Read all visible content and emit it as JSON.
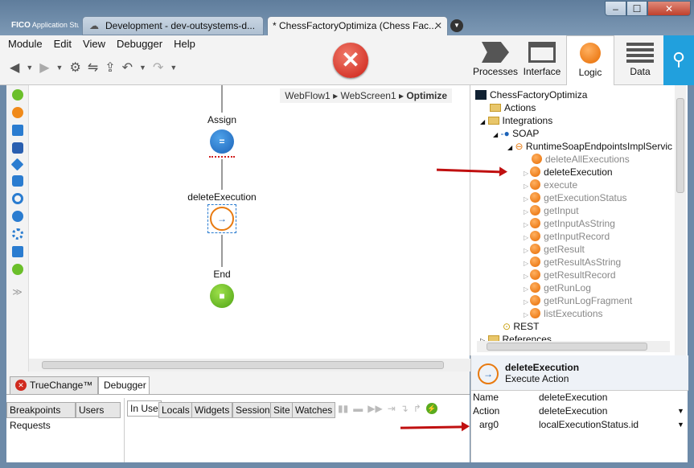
{
  "window": {
    "tabs": [
      {
        "label": "Development - dev-outsystems-d..."
      },
      {
        "label": "* ChessFactoryOptimiza (Chess Fac..."
      }
    ],
    "brand": "FICO",
    "brand_sub": "Application Studio"
  },
  "menu": [
    "Module",
    "Edit",
    "View",
    "Debugger",
    "Help"
  ],
  "nav": {
    "processes": "Processes",
    "interface": "Interface",
    "logic": "Logic",
    "data": "Data"
  },
  "breadcrumb": {
    "part1": "WebFlow1",
    "part2": "WebScreen1",
    "part3": "Optimize"
  },
  "flow": {
    "assign_label": "Assign",
    "action_label": "deleteExecution",
    "end_label": "End"
  },
  "tree": {
    "root": "ChessFactoryOptimiza",
    "actions": "Actions",
    "integrations": "Integrations",
    "soap": "SOAP",
    "service": "RuntimeSoapEndpointsImplServic",
    "methods": [
      "deleteAllExecutions",
      "deleteExecution",
      "execute",
      "getExecutionStatus",
      "getInput",
      "getInputAsString",
      "getInputRecord",
      "getResult",
      "getResultAsString",
      "getResultRecord",
      "getRunLog",
      "getRunLogFragment",
      "listExecutions"
    ],
    "rest": "REST",
    "references": "References"
  },
  "bottom": {
    "truechange": "TrueChange™",
    "debugger": "Debugger",
    "breakpoints": "Breakpoints",
    "users": "Users",
    "requests": "Requests",
    "subtabs": [
      "In Use",
      "Locals",
      "Widgets",
      "Session",
      "Site",
      "Watches"
    ]
  },
  "props": {
    "title": "deleteExecution",
    "subtitle": "Execute Action",
    "rows": [
      {
        "name": "Name",
        "value": "deleteExecution"
      },
      {
        "name": "Action",
        "value": "deleteExecution"
      },
      {
        "name": "arg0",
        "value": "localExecutionStatus.id"
      }
    ]
  }
}
